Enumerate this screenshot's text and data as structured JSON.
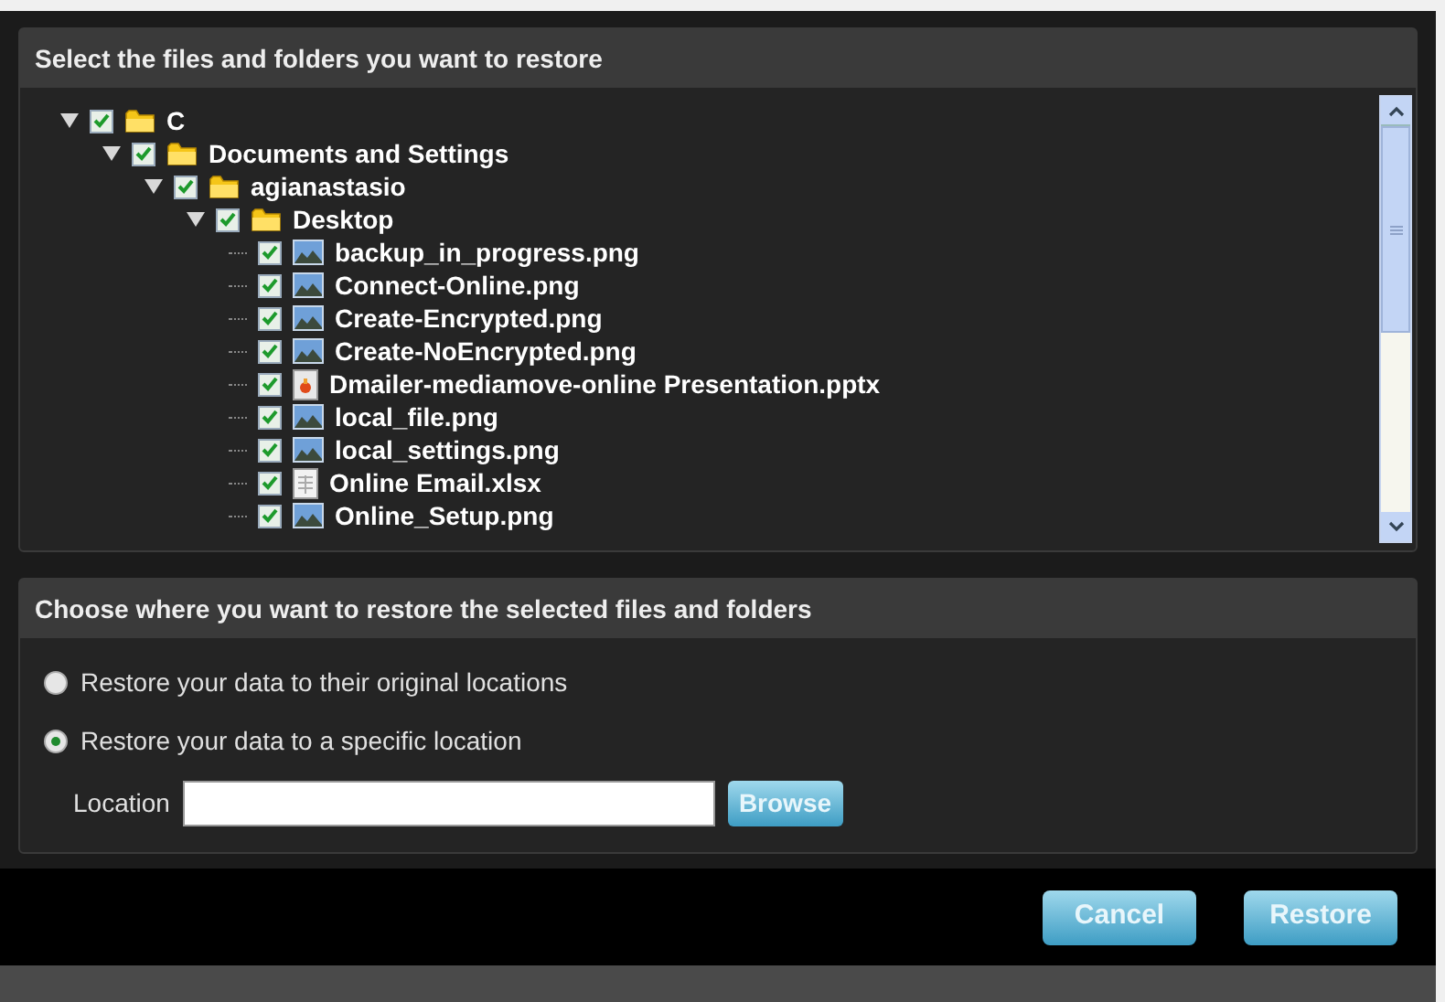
{
  "file_panel": {
    "title": "Select the files and folders you want to restore",
    "tree": [
      {
        "label": "C",
        "kind": "folder",
        "checked": true,
        "expanded": true,
        "children": [
          {
            "label": "Documents and Settings",
            "kind": "folder",
            "checked": true,
            "expanded": true,
            "children": [
              {
                "label": "agianastasio",
                "kind": "folder",
                "checked": true,
                "expanded": true,
                "children": [
                  {
                    "label": "Desktop",
                    "kind": "folder",
                    "checked": true,
                    "expanded": true,
                    "children": [
                      {
                        "label": "backup_in_progress.png",
                        "kind": "image",
                        "checked": true
                      },
                      {
                        "label": "Connect-Online.png",
                        "kind": "image",
                        "checked": true
                      },
                      {
                        "label": "Create-Encrypted.png",
                        "kind": "image",
                        "checked": true
                      },
                      {
                        "label": "Create-NoEncrypted.png",
                        "kind": "image",
                        "checked": true
                      },
                      {
                        "label": "Dmailer-mediamove-online Presentation.pptx",
                        "kind": "presentation",
                        "checked": true
                      },
                      {
                        "label": "local_file.png",
                        "kind": "image",
                        "checked": true
                      },
                      {
                        "label": "local_settings.png",
                        "kind": "image",
                        "checked": true
                      },
                      {
                        "label": "Online Email.xlsx",
                        "kind": "spreadsheet",
                        "checked": true
                      },
                      {
                        "label": "Online_Setup.png",
                        "kind": "image",
                        "checked": true
                      }
                    ]
                  }
                ]
              }
            ]
          }
        ]
      }
    ]
  },
  "location_panel": {
    "title": "Choose where you want to restore the selected files and folders",
    "options": [
      {
        "label": "Restore your data to their original locations",
        "selected": false
      },
      {
        "label": "Restore your data to a specific location",
        "selected": true
      }
    ],
    "location_label": "Location",
    "browse": "Browse"
  },
  "buttons": [
    "Cancel",
    "Restore"
  ]
}
